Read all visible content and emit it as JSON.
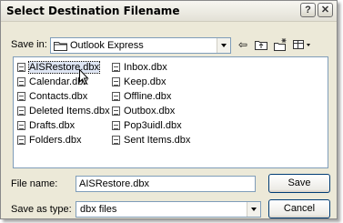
{
  "window": {
    "title": "Select Destination Filename",
    "help_label": "?",
    "close_label": "✕"
  },
  "save_in": {
    "label": "Save in:",
    "value": "Outlook Express"
  },
  "toolbar": {
    "back_icon": "⇦",
    "up_icon": "up-folder-icon",
    "new_folder_icon": "new-folder-icon",
    "views_icon": "views-menu-icon"
  },
  "files": {
    "col1": [
      "AISRestore.dbx",
      "Calendar.dbx",
      "Contacts.dbx",
      "Deleted Items.dbx",
      "Drafts.dbx",
      "Folders.dbx"
    ],
    "col2": [
      "Inbox.dbx",
      "Keep.dbx",
      "Offline.dbx",
      "Outbox.dbx",
      "Pop3uidl.dbx",
      "Sent Items.dbx"
    ],
    "selected": "AISRestore.dbx"
  },
  "file_name": {
    "label": "File name:",
    "value": "AISRestore.dbx"
  },
  "save_as_type": {
    "label": "Save as type:",
    "value": "dbx files"
  },
  "buttons": {
    "save": "Save",
    "cancel": "Cancel"
  }
}
